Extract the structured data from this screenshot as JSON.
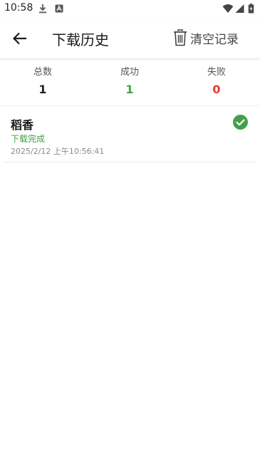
{
  "status_bar": {
    "time": "10:58"
  },
  "app_bar": {
    "title": "下载历史",
    "clear_label": "清空记录"
  },
  "stats": {
    "total_label": "总数",
    "total_value": "1",
    "success_label": "成功",
    "success_value": "1",
    "failed_label": "失败",
    "failed_value": "0"
  },
  "history": [
    {
      "name": "稻香",
      "status": "下载完成",
      "time": "2025/2/12 上午10:56:41",
      "icon": "check-circle-icon"
    }
  ],
  "colors": {
    "success": "#43a047",
    "failed": "#e53935",
    "total": "#222222"
  }
}
